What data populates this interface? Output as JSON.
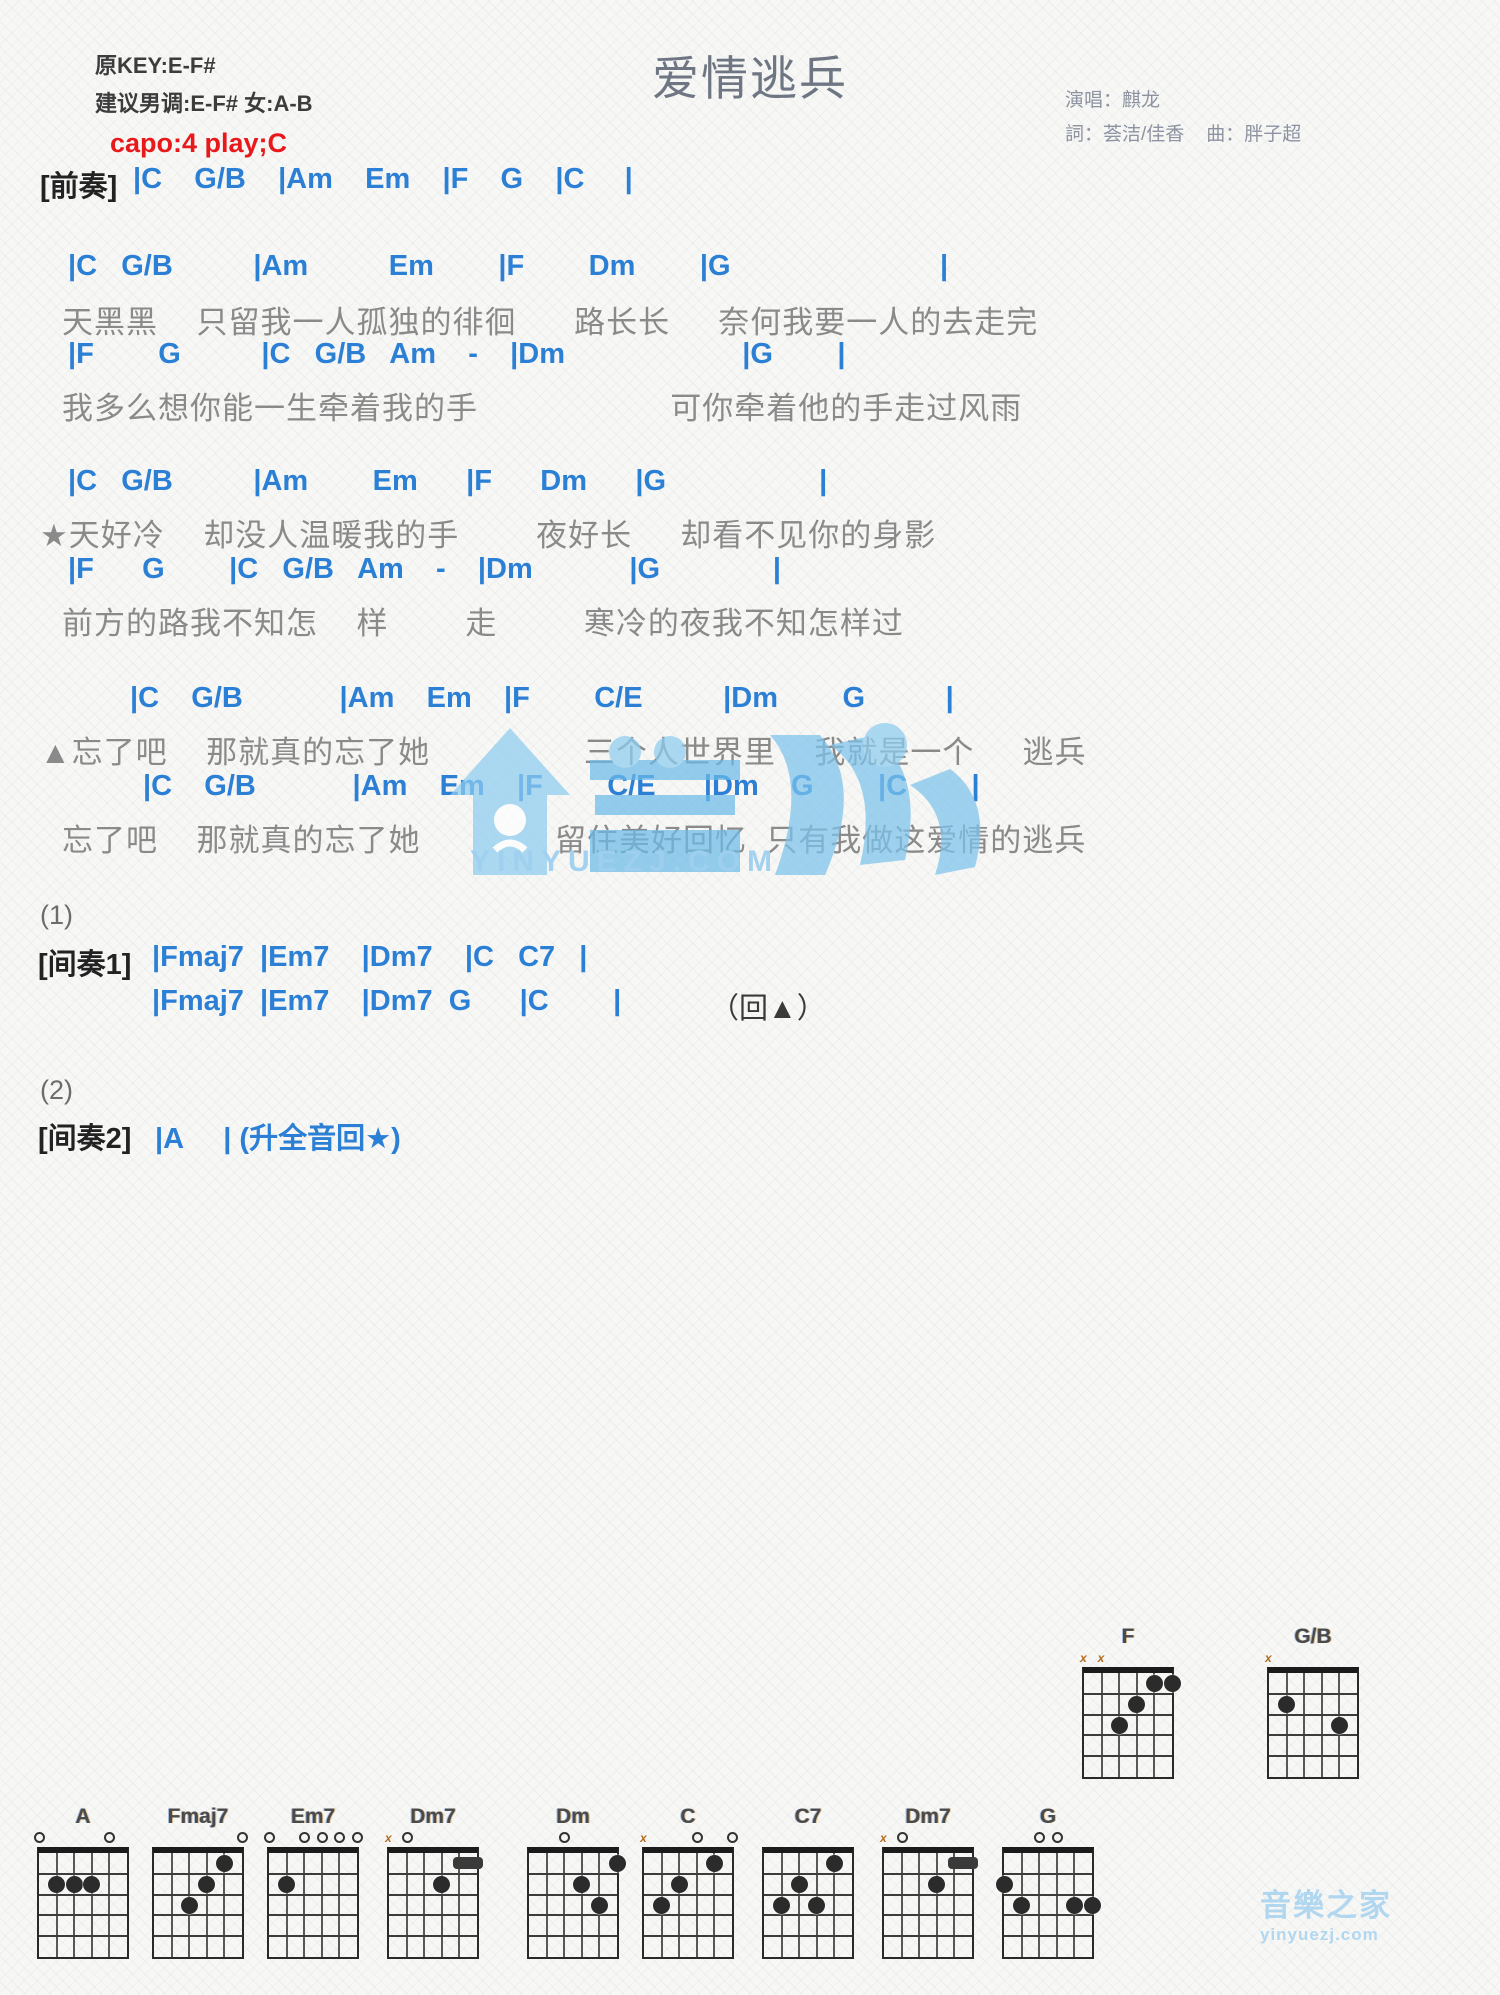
{
  "header": {
    "title": "爱情逃兵",
    "key_original": "原KEY:E-F#",
    "key_suggest": "建议男调:E-F# 女:A-B",
    "capo": "capo:4 play;C",
    "singer": "演唱：麒龙",
    "lyricist": "詞：荟洁/佳香",
    "composer": "曲：胖子超",
    "accent_color": "#2b7fd4",
    "capo_color": "#e8191b"
  },
  "sections": {
    "intro_tag": "[前奏]",
    "intro_chords": "|C    G/B    |Am    Em    |F    G    |C     |",
    "verse1": {
      "chords_a": "|C   G/B          |Am          Em        |F        Dm        |G                          |",
      "lyrics_a": "天黑黑    只留我一人孤独的徘徊      路长长     奈何我要一人的去走完",
      "chords_b": "|F        G          |C   G/B   Am    -    |Dm                      |G        |",
      "lyrics_b": "我多么想你能一生牵着我的手                    可你牵着他的手走过风雨"
    },
    "verse2": {
      "chords_a": "|C   G/B          |Am        Em      |F      Dm      |G                   |",
      "lyrics_a": "★天好冷    却没人温暖我的手        夜好长     却看不见你的身影",
      "chords_b": "|F      G        |C   G/B   Am    -    |Dm            |G              |",
      "lyrics_b": "前方的路我不知怎    样        走         寒冷的夜我不知怎样过"
    },
    "chorus": {
      "chords_a": "|C    G/B            |Am    Em    |F        C/E          |Dm        G          |",
      "lyrics_a": "▲忘了吧    那就真的忘了她                三个人世界里    我就是一个     逃兵",
      "chords_b": "|C    G/B            |Am    Em    |F        C/E      |Dm    G        |C        |",
      "lyrics_b": "忘了吧    那就真的忘了她              留住美好回忆  只有我做这爱情的逃兵"
    },
    "interlude1": {
      "number": "(1)",
      "tag": "[间奏1]",
      "row1": "|Fmaj7  |Em7    |Dm7    |C   C7   |",
      "row2": "|Fmaj7  |Em7    |Dm7  G      |C        |",
      "repeat_note": "（回▲）"
    },
    "interlude2": {
      "number": "(2)",
      "tag": "[间奏2]",
      "row1": "|A     | (升全音回★)"
    }
  },
  "watermark": {
    "brand": "音楽之家",
    "site": "YINYUEZJ.COM",
    "corner_brand": "音樂之家",
    "corner_site": "yinyuezj.com"
  },
  "chord_diagrams_row_top": [
    {
      "name": "F",
      "open_markers": [
        {
          "type": "x",
          "string": 1
        },
        {
          "type": "x",
          "string": 2
        }
      ],
      "dots": [
        {
          "string": 3,
          "fret": 3
        },
        {
          "string": 4,
          "fret": 2
        },
        {
          "string": 5,
          "fret": 1
        },
        {
          "string": 6,
          "fret": 1
        }
      ]
    },
    {
      "name": "G/B",
      "open_markers": [
        {
          "type": "x",
          "string": 1
        }
      ],
      "dots": [
        {
          "string": 2,
          "fret": 2
        },
        {
          "string": 5,
          "fret": 3
        }
      ]
    }
  ],
  "chord_diagrams_row_bottom": [
    {
      "name": "A",
      "open_markers": [
        {
          "type": "o",
          "string": 1
        },
        {
          "type": "o",
          "string": 5
        }
      ],
      "dots": [
        {
          "string": 2,
          "fret": 2
        },
        {
          "string": 3,
          "fret": 2
        },
        {
          "string": 4,
          "fret": 2
        }
      ]
    },
    {
      "name": "Fmaj7",
      "open_markers": [
        {
          "type": "o",
          "string": 6
        }
      ],
      "dots": [
        {
          "string": 3,
          "fret": 3
        },
        {
          "string": 4,
          "fret": 2
        },
        {
          "string": 5,
          "fret": 1
        }
      ]
    },
    {
      "name": "Em7",
      "open_markers": [
        {
          "type": "o",
          "string": 1
        },
        {
          "type": "o",
          "string": 3
        },
        {
          "type": "o",
          "string": 4
        },
        {
          "type": "o",
          "string": 5
        },
        {
          "type": "o",
          "string": 6
        }
      ],
      "dots": [
        {
          "string": 2,
          "fret": 2
        }
      ]
    },
    {
      "name": "Dm7",
      "open_markers": [
        {
          "type": "x",
          "string": 1
        },
        {
          "type": "o",
          "string": 2
        }
      ],
      "dots": [
        {
          "string": 4,
          "fret": 2
        }
      ],
      "barre": {
        "fret": 1,
        "from": 5,
        "to": 6
      }
    },
    {
      "name": "Dm",
      "open_markers": [
        {
          "type": "o",
          "string": 3
        }
      ],
      "dots": [
        {
          "string": 4,
          "fret": 2
        },
        {
          "string": 5,
          "fret": 3
        },
        {
          "string": 6,
          "fret": 1
        }
      ]
    },
    {
      "name": "C",
      "open_markers": [
        {
          "type": "x",
          "string": 1
        },
        {
          "type": "o",
          "string": 4
        },
        {
          "type": "o",
          "string": 6
        }
      ],
      "dots": [
        {
          "string": 2,
          "fret": 3
        },
        {
          "string": 3,
          "fret": 2
        },
        {
          "string": 5,
          "fret": 1
        }
      ]
    },
    {
      "name": "C7",
      "open_markers": [],
      "dots": [
        {
          "string": 2,
          "fret": 3
        },
        {
          "string": 3,
          "fret": 2
        },
        {
          "string": 4,
          "fret": 3
        },
        {
          "string": 5,
          "fret": 1
        }
      ]
    },
    {
      "name": "Dm7",
      "open_markers": [
        {
          "type": "x",
          "string": 1
        },
        {
          "type": "o",
          "string": 2
        }
      ],
      "dots": [
        {
          "string": 4,
          "fret": 2
        }
      ],
      "barre": {
        "fret": 1,
        "from": 5,
        "to": 6
      }
    },
    {
      "name": "G",
      "open_markers": [
        {
          "type": "o",
          "string": 3
        },
        {
          "type": "o",
          "string": 4
        }
      ],
      "dots": [
        {
          "string": 1,
          "fret": 2
        },
        {
          "string": 2,
          "fret": 3
        },
        {
          "string": 5,
          "fret": 3
        },
        {
          "string": 6,
          "fret": 3
        }
      ]
    }
  ]
}
